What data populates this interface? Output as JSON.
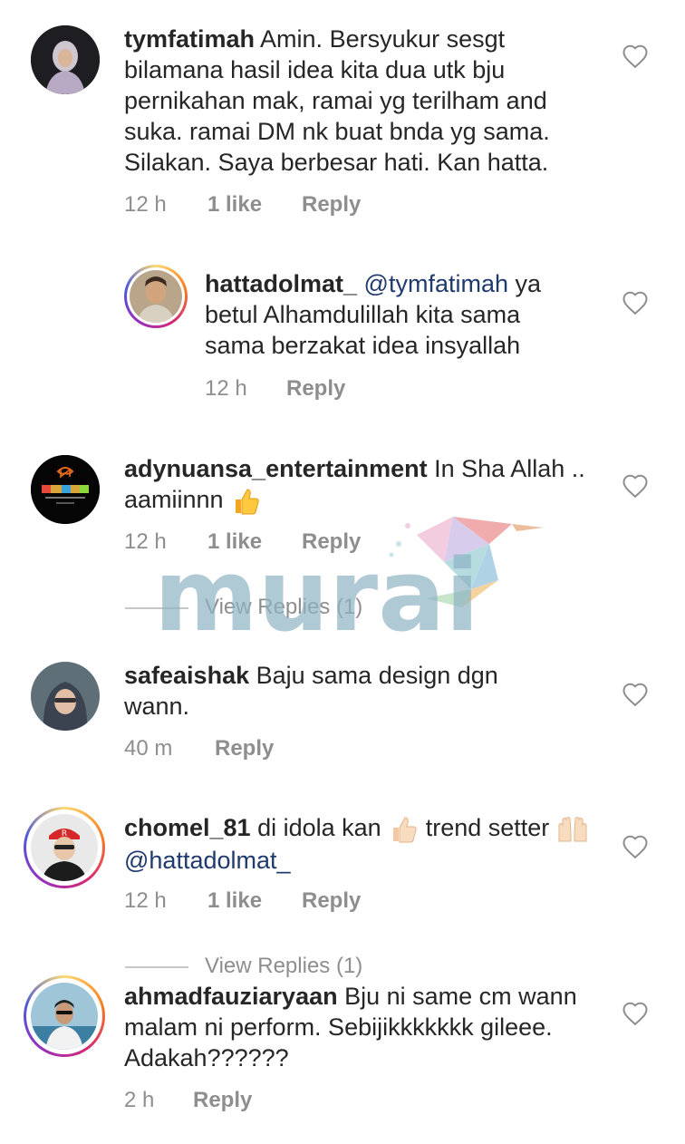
{
  "comments": [
    {
      "username": "tymfatimah",
      "text": "Amin. Bersyukur sesgt bilamana hasil idea kita dua utk bju pernikahan mak, ramai yg terilham and suka. ramai DM nk buat bnda yg sama. Silakan. Saya berbesar hati. Kan hatta.",
      "time": "12 h",
      "likes": "1 like",
      "reply": "Reply"
    },
    {
      "username": "hattadolmat_",
      "mention": "@tymfatimah",
      "text": "ya betul Alhamdulillah kita sama sama berzakat idea insyallah",
      "time": "12 h",
      "reply": "Reply"
    },
    {
      "username": "adynuansa_entertainment",
      "text": "In Sha Allah .. aamiinnn",
      "time": "12 h",
      "likes": "1 like",
      "reply": "Reply",
      "view_replies": "View Replies (1)"
    },
    {
      "username": "safeaishak",
      "text": "Baju sama design dgn wann.",
      "time": "40 m",
      "reply": "Reply"
    },
    {
      "username": "chomel_81",
      "text_before": "di idola kan",
      "text_after": "trend setter",
      "mention": "@hattadolmat_",
      "time": "12 h",
      "likes": "1 like",
      "reply": "Reply",
      "view_replies": "View Replies (1)"
    },
    {
      "username": "ahmadfauziaryaan",
      "text": "Bju ni same cm wann malam ni perform. Sebijikkkkkkk gileee. Adakah??????",
      "time": "2 h",
      "reply": "Reply"
    }
  ],
  "watermark": {
    "text": "murai"
  },
  "colors": {
    "text": "#262626",
    "meta": "#8e8e8e",
    "mention": "#1f3a6e",
    "watermark": "#8fb4c4"
  },
  "icons": {
    "like": "heart-outline-icon",
    "thumbs_up": "thumbs-up-emoji",
    "raised_hands": "raising-hands-emoji"
  }
}
